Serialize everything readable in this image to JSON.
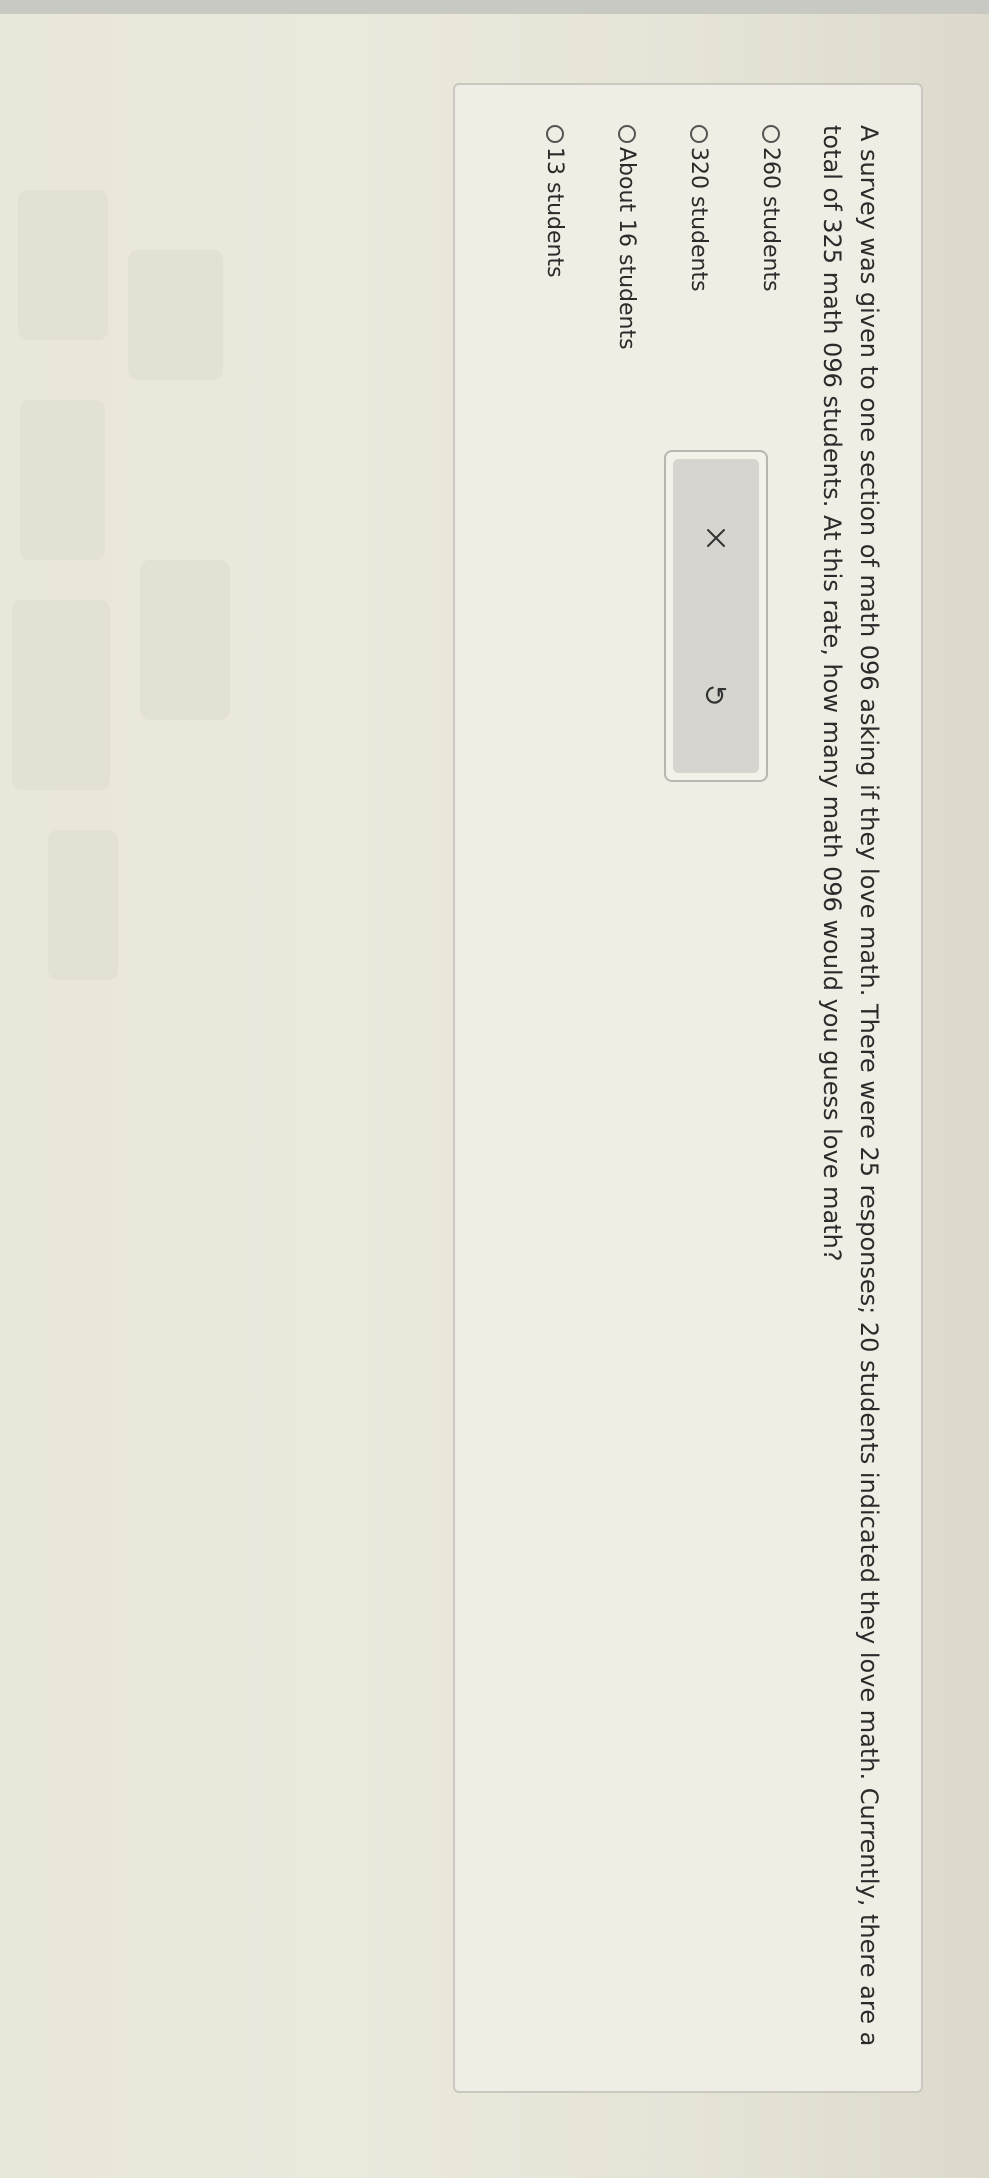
{
  "question": {
    "text": "A survey was given to one section of math 096 asking if they love math. There were 25 responses; 20 students indicated they love math. Currently, there are a total of 325 math 096 students. At this rate, how many math 096 would you guess love math?"
  },
  "options": [
    {
      "label": "260 students"
    },
    {
      "label": "320 students"
    },
    {
      "label": "About 16 students"
    },
    {
      "label": "13 students"
    }
  ],
  "actions": {
    "clear_icon": "close-icon",
    "undo_icon": "undo-icon"
  },
  "colors": {
    "text": "#2b2b2b",
    "card_background": "#f0eee4",
    "button_panel": "#d6d5cf"
  }
}
